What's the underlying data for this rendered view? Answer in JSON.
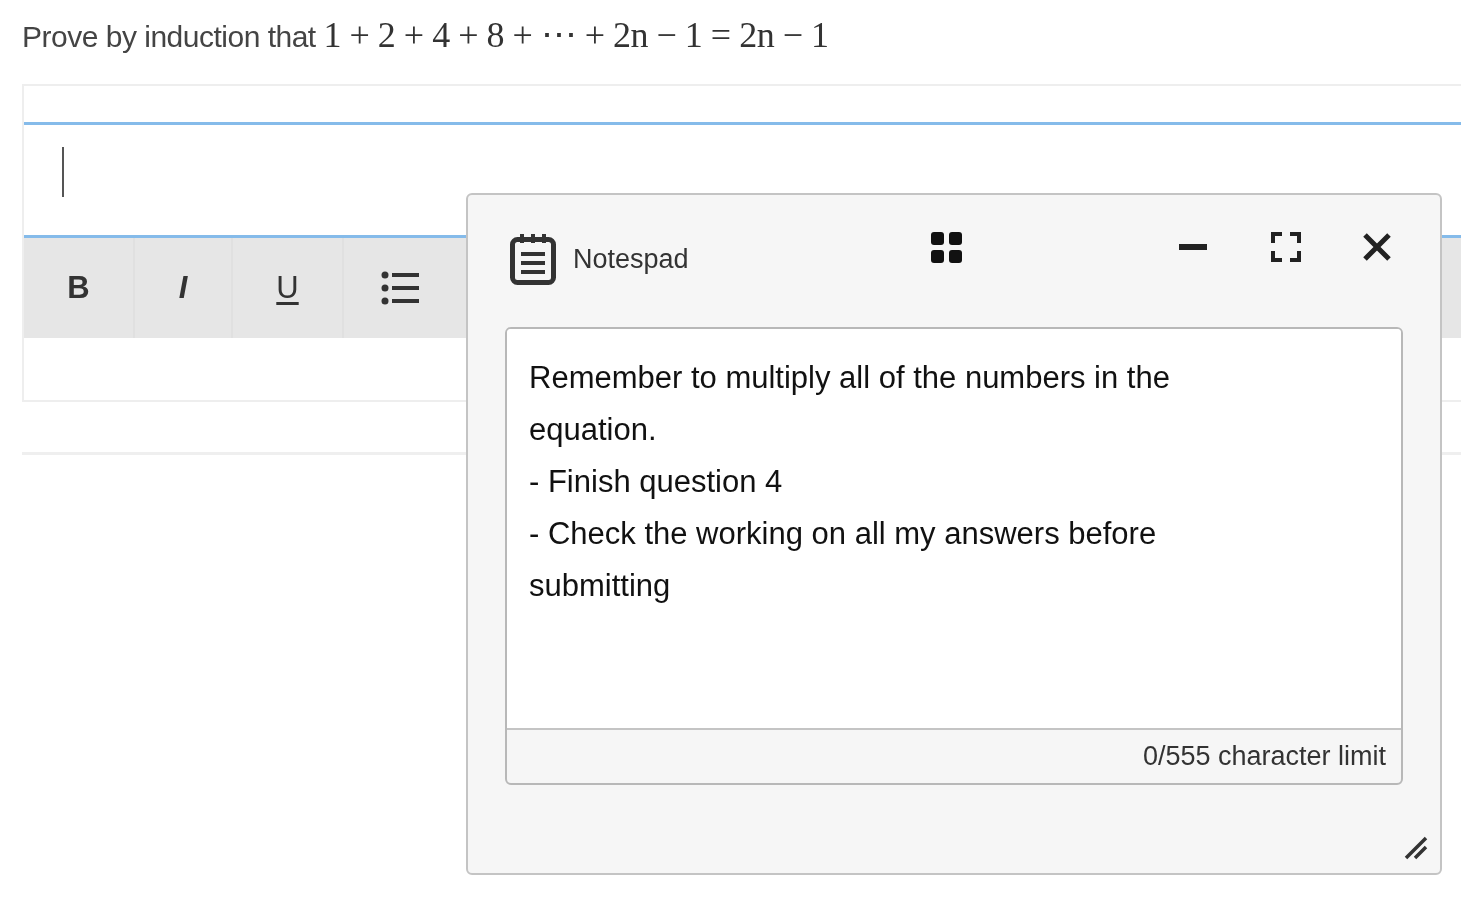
{
  "question": {
    "text": "Prove by induction that",
    "math": "1 + 2 + 4 + 8 + ⋯ + 2n − 1 = 2n − 1"
  },
  "editor": {
    "toolbar": [
      {
        "kind": "bold",
        "label": "B"
      },
      {
        "kind": "italic",
        "label": "I"
      },
      {
        "kind": "underline",
        "label": "U"
      },
      {
        "kind": "list"
      }
    ]
  },
  "notepad": {
    "title": "Notespad",
    "note": "Remember to multiply all of the numbers in the equation.\n- Finish question 4\n- Check the working on all my answers before submitting",
    "counter": "0/555 character limit"
  }
}
